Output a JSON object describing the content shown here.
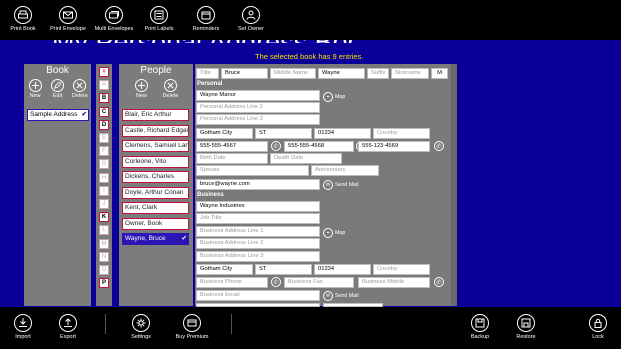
{
  "top_commands": [
    {
      "label": "Print Book",
      "icon": "print-icon"
    },
    {
      "label": "Print Envelope",
      "icon": "envelope-icon"
    },
    {
      "label": "Multi Envelopes",
      "icon": "multi-envelope-icon"
    },
    {
      "label": "Print Labels",
      "icon": "labels-icon"
    },
    {
      "label": "Reminders",
      "icon": "reminder-icon"
    },
    {
      "label": "Set Owner",
      "icon": "user-icon"
    }
  ],
  "app_title": "My Personal Address Book",
  "subtitle": "The selected book has 9 entries.",
  "book_panel": {
    "header": "Book",
    "new": "New",
    "edit": "Edit",
    "delete": "Delete",
    "items": [
      "Sample Address"
    ]
  },
  "letters": [
    "#",
    "A",
    "B",
    "C",
    "D",
    "E",
    "F",
    "G",
    "H",
    "I",
    "J",
    "K",
    "L",
    "M",
    "N",
    "O",
    "P"
  ],
  "enabled_letters": [
    "B",
    "C",
    "D",
    "K",
    "P"
  ],
  "people_panel": {
    "header": "People",
    "new": "New",
    "delete": "Delete",
    "items": [
      "Blair, Eric Arthur",
      "Castle, Richard Edgar",
      "Clemens, Samuel Langhorne",
      "Corleone, Vito",
      "Dickens, Charles",
      "Doyle, Arthur Conan",
      "Kent, Clark",
      "Owner, Book",
      "Wayne, Bruce"
    ],
    "selected": "Wayne, Bruce"
  },
  "detail": {
    "title_ph": "Title",
    "first": "Bruce",
    "middle_ph": "Middle Name",
    "last": "Wayne",
    "suffix_ph": "Suffix",
    "nickname_ph": "Nickname",
    "gender": "M",
    "personal_label": "Personal",
    "address1": "Wayne Manor",
    "address2_ph": "Personal Address Line 2",
    "address3_ph": "Personal Address Line 3",
    "city": "Gotham City",
    "state": "ST",
    "zip": "01234",
    "country_ph": "Country",
    "phone1": "555-555-4567",
    "phone2": "555-555-4568",
    "phone3": "555-123-4569",
    "birth_ph": "Birth Date",
    "death_ph": "Death Date",
    "spouse_ph": "Spouse",
    "anniv_ph": "Anniversary",
    "email": "bruce@wayne.com",
    "map": "Map",
    "send_mail": "Send Mail",
    "business_label": "Business",
    "company": "Wayne Industries",
    "job_ph": "Job Title",
    "baddr1_ph": "Business Address Line 1",
    "baddr2_ph": "Business Address Line 2",
    "baddr3_ph": "Business Address Line 3",
    "bcity": "Gotham City",
    "bstate": "ST",
    "bzip": "01234",
    "bcountry_ph": "Country",
    "bphone_ph": "Business Phone",
    "bfax_ph": "Business Fax",
    "bmobile_ph": "Business Mobile",
    "bemail_ph": "Business Email",
    "custom1_ph": "Custom 1",
    "custom2_ph": "Custom 2"
  },
  "bottom_commands": {
    "left": [
      "Import",
      "Export",
      "Settings",
      "Buy Premium"
    ],
    "right": [
      "Backup",
      "Restore",
      "Lock"
    ]
  }
}
